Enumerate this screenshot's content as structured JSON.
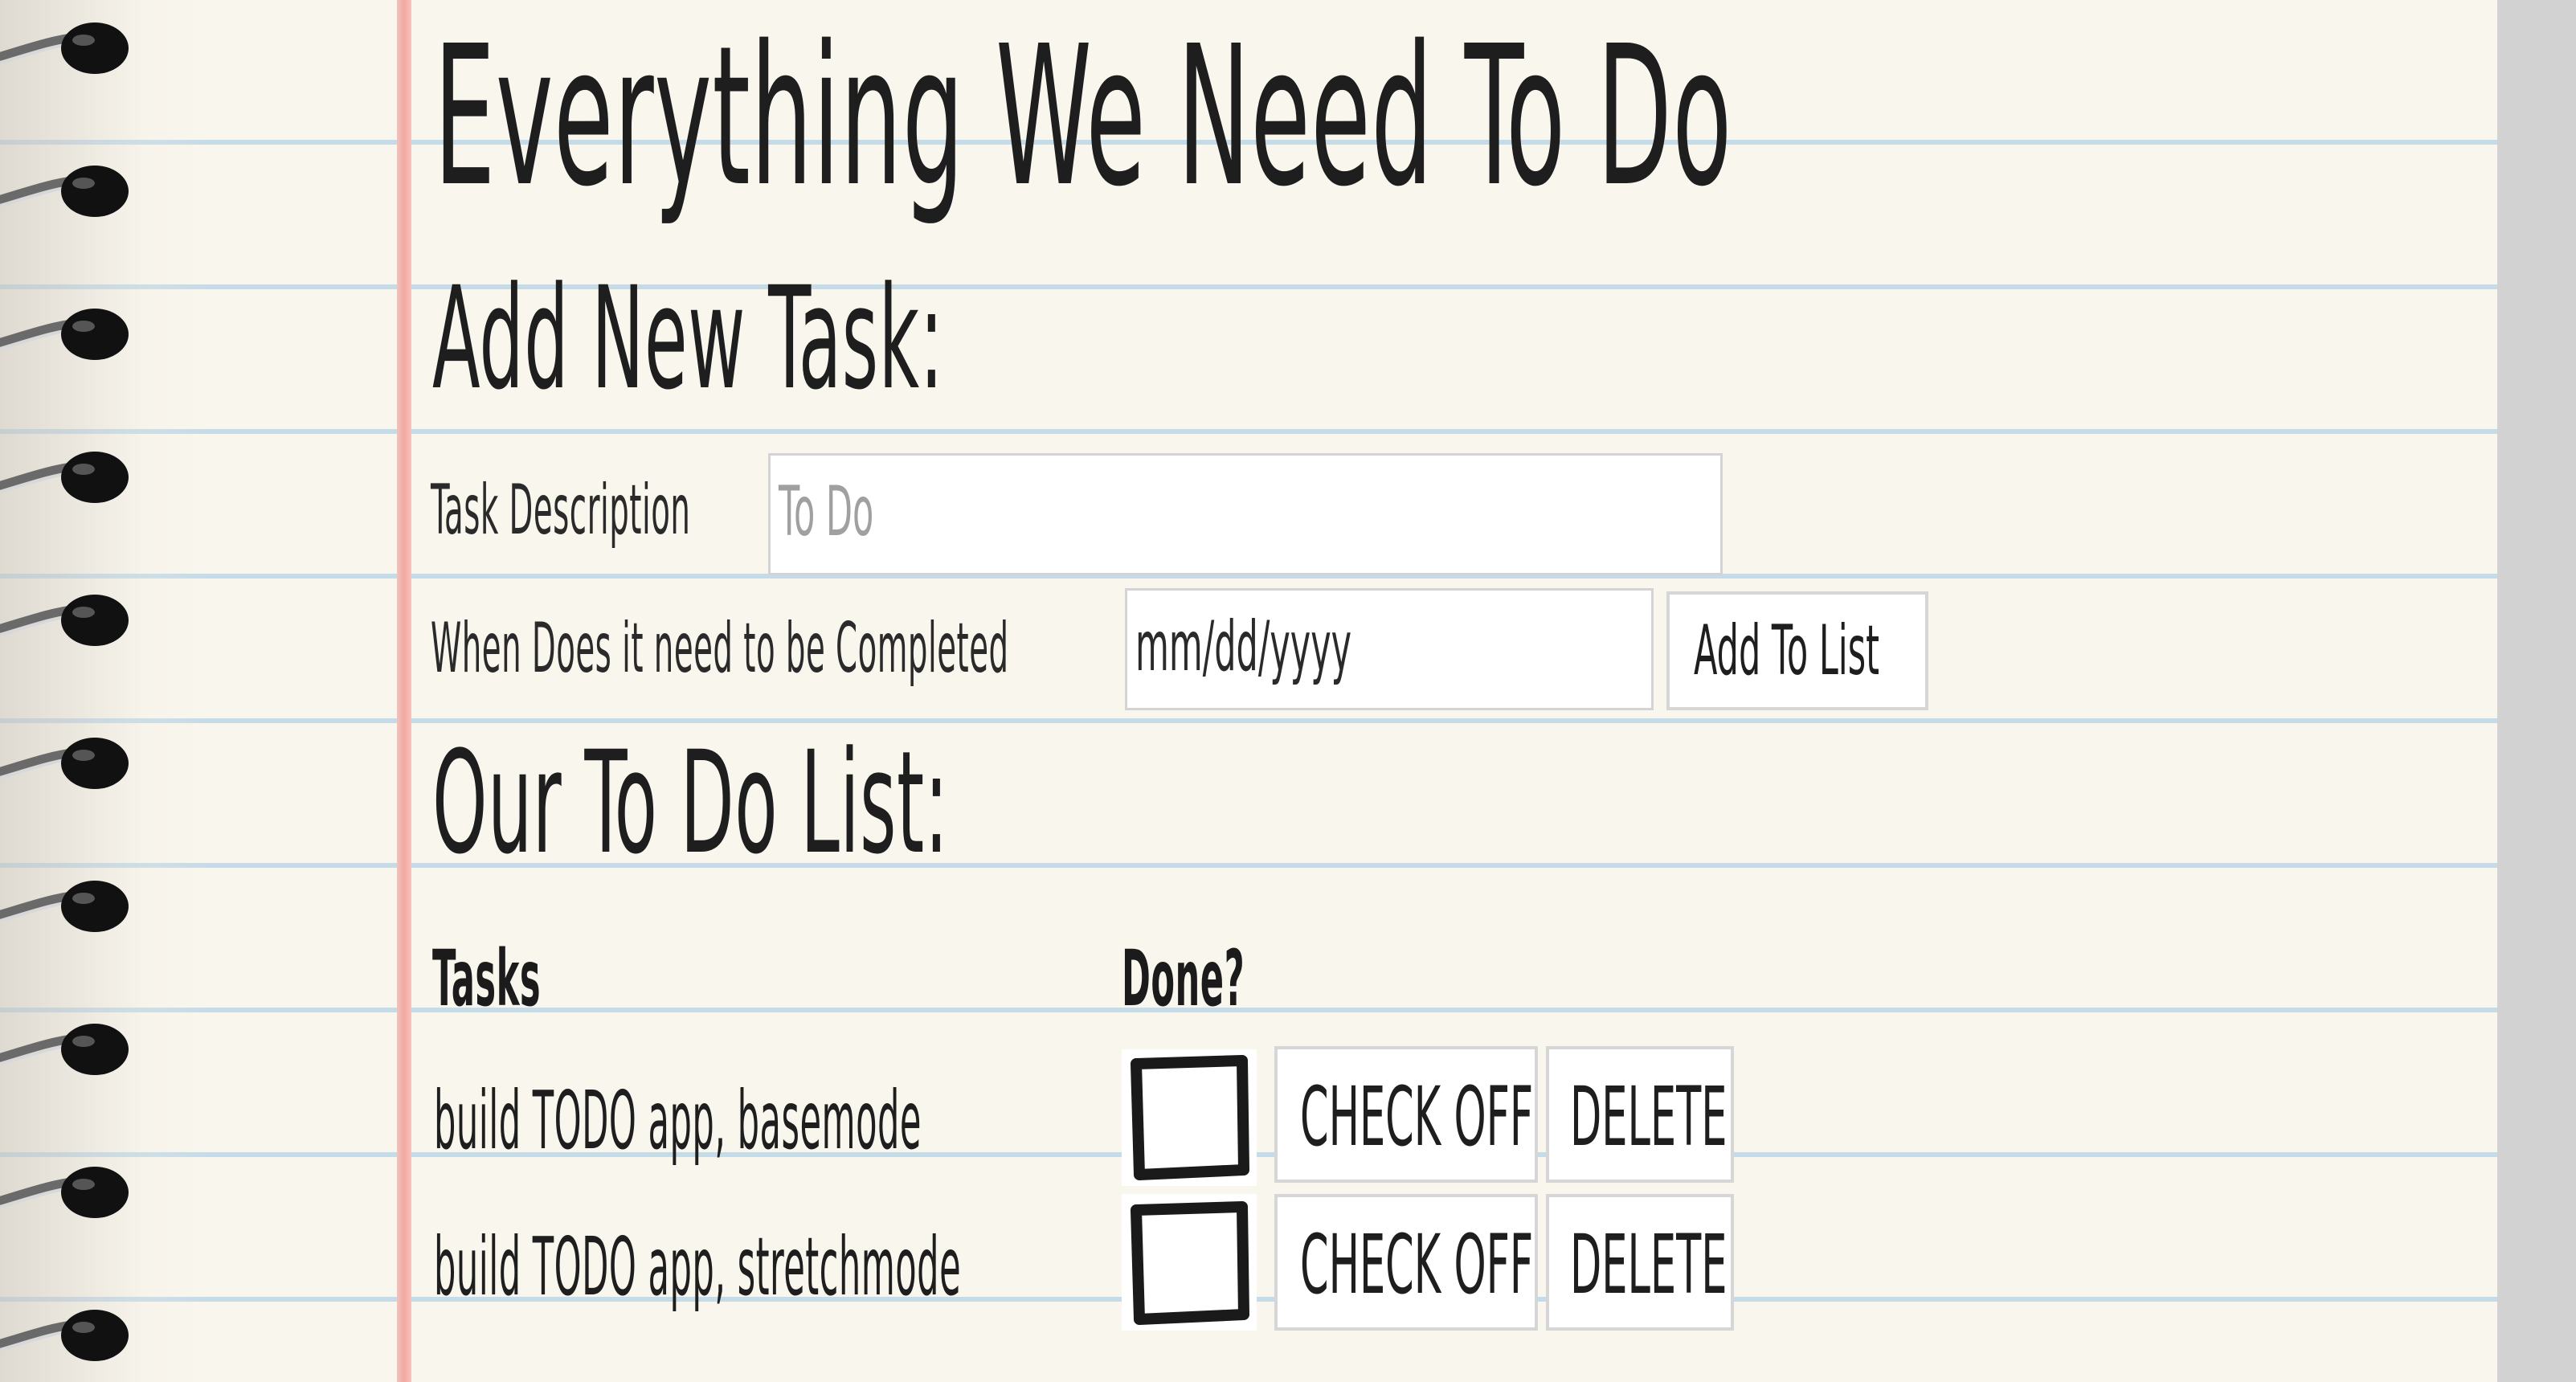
{
  "page": {
    "title": "Everything We Need To Do"
  },
  "add_task": {
    "heading": "Add New Task:",
    "description_label": "Task Description",
    "description_placeholder": "To Do",
    "date_label": "When Does it need to be Completed",
    "date_placeholder": "mm/dd/yyyy",
    "add_button_label": "Add To List"
  },
  "todo_list": {
    "heading": "Our To Do List:",
    "columns": [
      "Tasks",
      "Done?"
    ],
    "rows": [
      {
        "task": "build TODO app, basemode",
        "check_label": "CHECK OFF",
        "delete_label": "DELETE"
      },
      {
        "task": "build TODO app, stretchmode",
        "check_label": "CHECK OFF",
        "delete_label": "DELETE"
      }
    ]
  },
  "colors": {
    "paper": "#f9f6ee",
    "rule_line": "#c6dbe8",
    "margin_line": "#f4a8a0",
    "ink": "#1e1e1e",
    "scrollbar": "#d2d2d2"
  },
  "icons": [
    "spiral-ring-icon",
    "checkbox-icon"
  ]
}
